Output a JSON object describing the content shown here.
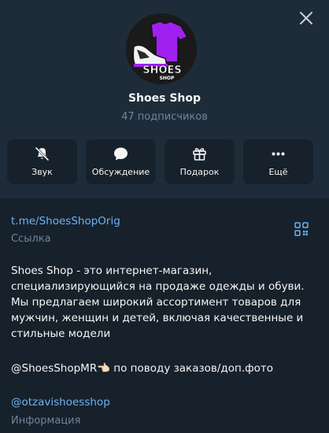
{
  "profile": {
    "name": "Shoes Shop",
    "subscribers": "47 подписчиков",
    "avatar_text_line1": "SHOES",
    "avatar_text_line2": "SHOP"
  },
  "actions": [
    {
      "label": "Звук",
      "icon": "bell-off-icon"
    },
    {
      "label": "Обсуждение",
      "icon": "chat-bubble-icon"
    },
    {
      "label": "Подарок",
      "icon": "gift-icon"
    },
    {
      "label": "Ещё",
      "icon": "more-dots-icon"
    }
  ],
  "info": {
    "link": "t.me/ShoesShopOrig",
    "link_caption": "Ссылка",
    "description": "Shoes Shop - это интернет-магазин, специализирующийся на продаже одежды и обуви. Мы предлагаем широкий ассортимент товаров для мужчин, женщин и детей, включая качественные и стильные модели",
    "contact": "@ShoesShopMR👈🏻 по поводу заказов/доп.фото",
    "username": "@otzavishoesshop",
    "info_caption": "Информация"
  },
  "colors": {
    "background": "#17212b",
    "header": "#1e2c3a",
    "accent": "#6ab3f3",
    "muted": "#708499",
    "avatar_purple": "#a020f0"
  }
}
